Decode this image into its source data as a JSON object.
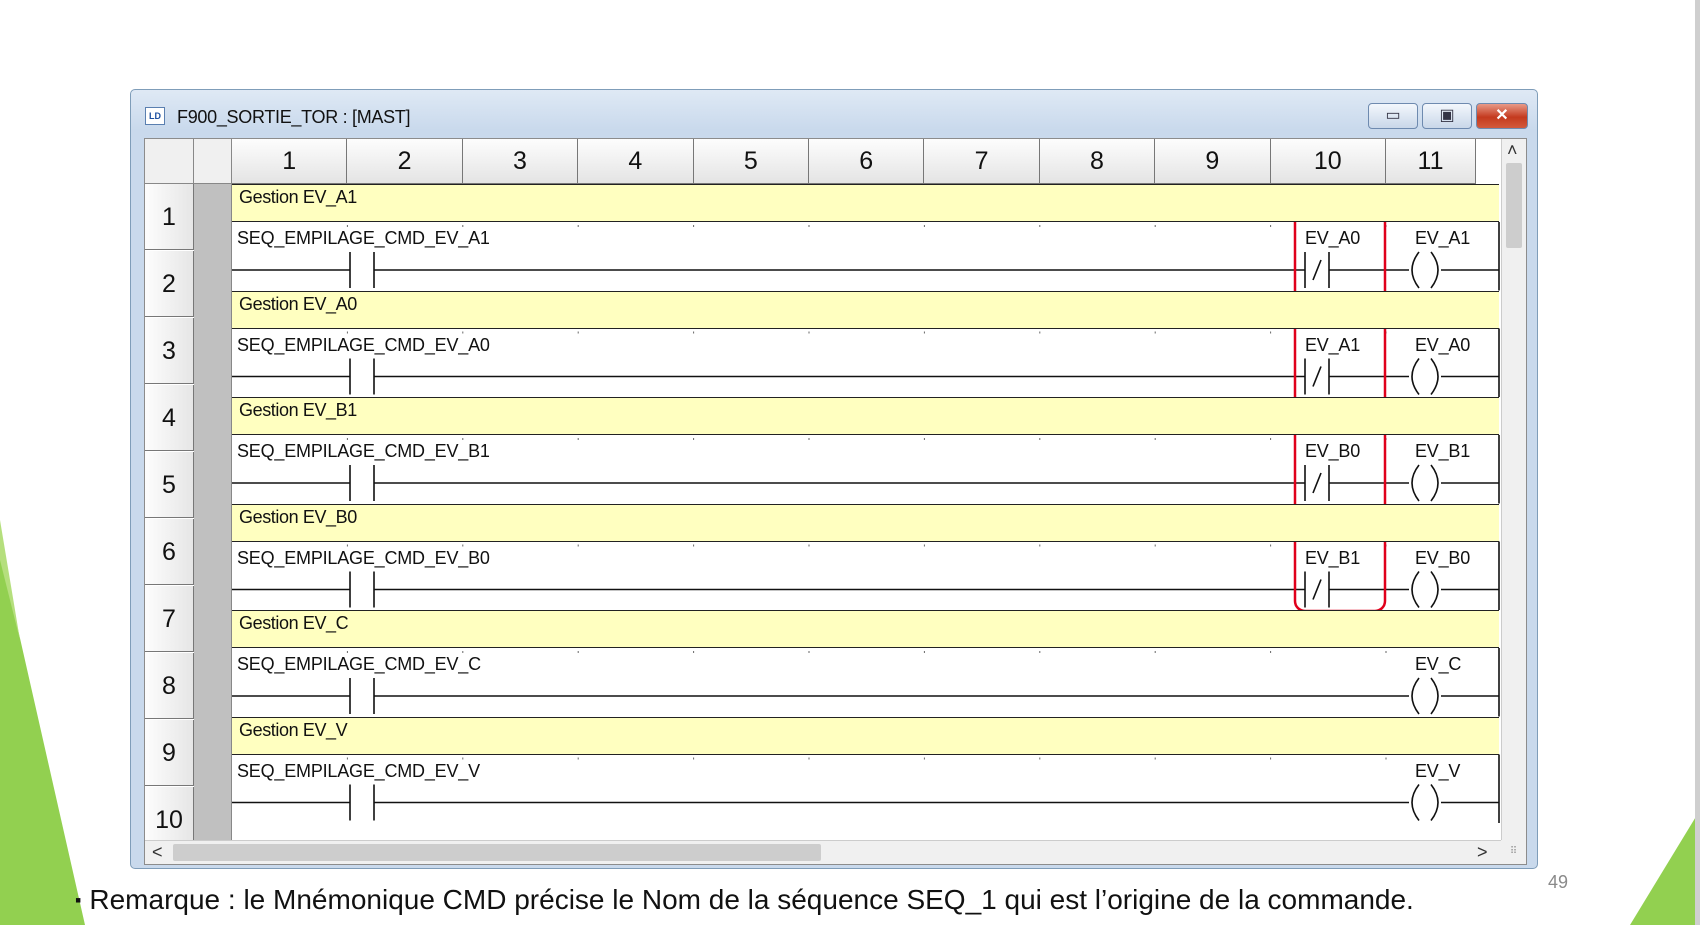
{
  "window": {
    "title": "F900_SORTIE_TOR : [MAST]",
    "icon_text": "LD",
    "minimize_glyph": "▭",
    "maximize_glyph": "▣",
    "close_glyph": "✕"
  },
  "columns": [
    "1",
    "2",
    "3",
    "4",
    "5",
    "6",
    "7",
    "8",
    "9",
    "10",
    "11"
  ],
  "rows": [
    "1",
    "2",
    "3",
    "4",
    "5",
    "6",
    "7",
    "8",
    "9",
    "10"
  ],
  "rungs": [
    {
      "comment": "Gestion EV_A1",
      "contact": "SEQ_EMPILAGE_CMD_EV_A1",
      "interlock": "EV_A0",
      "coil": "EV_A1"
    },
    {
      "comment": "Gestion EV_A0",
      "contact": "SEQ_EMPILAGE_CMD_EV_A0",
      "interlock": "EV_A1",
      "coil": "EV_A0"
    },
    {
      "comment": "Gestion EV_B1",
      "contact": "SEQ_EMPILAGE_CMD_EV_B1",
      "interlock": "EV_B0",
      "coil": "EV_B1"
    },
    {
      "comment": "Gestion EV_B0",
      "contact": "SEQ_EMPILAGE_CMD_EV_B0",
      "interlock": "EV_B1",
      "coil": "EV_B0"
    },
    {
      "comment": "Gestion EV_C",
      "contact": "SEQ_EMPILAGE_CMD_EV_C",
      "interlock": "",
      "coil": "EV_C"
    },
    {
      "comment": "Gestion EV_V",
      "contact": "SEQ_EMPILAGE_CMD_EV_V",
      "interlock": "",
      "coil": "EV_V"
    }
  ],
  "scroll": {
    "up": "˄",
    "left": "<",
    "right": ">",
    "grip": "⠿"
  },
  "remark": {
    "bullet": "▪",
    "text": "Remarque : le Mnémonique CMD précise le Nom de la séquence SEQ_1 qui est l’origine de la commande."
  },
  "page_number": "49",
  "colors": {
    "comment_bg": "#ffffc0",
    "highlight": "#e0001b",
    "accent_green": "#92d050"
  }
}
